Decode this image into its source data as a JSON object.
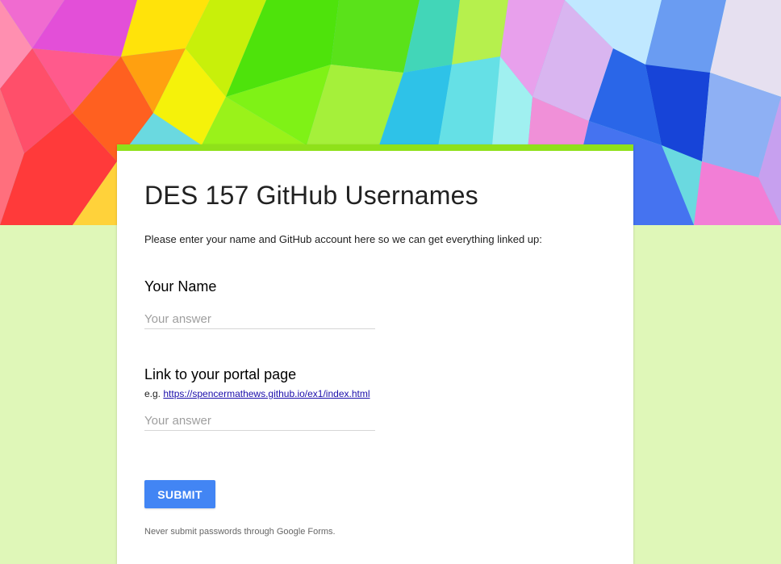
{
  "form": {
    "title": "DES 157 GitHub Usernames",
    "description": "Please enter your name and GitHub account here so we can get everything linked up:",
    "accent_color": "#8fe11a",
    "background_color": "#dff7b8",
    "questions": [
      {
        "title": "Your Name",
        "placeholder": "Your answer",
        "value": ""
      },
      {
        "title": "Link to your portal page",
        "help_prefix": "e.g.",
        "help_link": "https://spencermathews.github.io/ex1/index.html",
        "placeholder": "Your answer",
        "value": ""
      }
    ],
    "submit_label": "SUBMIT",
    "submit_color": "#4285f4",
    "footer_note": "Never submit passwords through Google Forms."
  }
}
